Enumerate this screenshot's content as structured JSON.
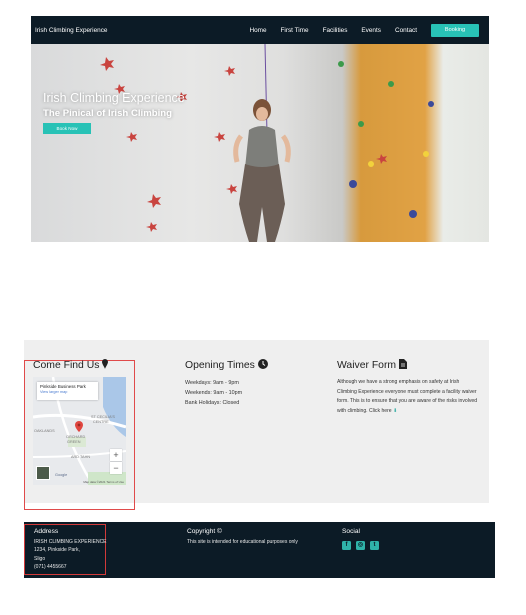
{
  "nav": {
    "brand": "Irish Climbing Experience",
    "links": [
      "Home",
      "First Time",
      "Facilities",
      "Events",
      "Contact"
    ],
    "cta": "Booking"
  },
  "hero": {
    "title": "Irish Climbing Experience",
    "subtitle": "The Pinical of Irish Climbing",
    "button": "Book Now"
  },
  "find_us": {
    "title": "Come Find Us",
    "icon": "map-marker-icon",
    "map": {
      "place": "Pinkside Business Park",
      "link": "View larger map",
      "labels": [
        "ST CECILIA'S",
        "CENTRE",
        "OAKLANDS",
        "ORCHARD",
        "GREEN",
        "ARD TAHN"
      ],
      "google": "Google",
      "footer": "Map data ©2021  Terms of Use"
    }
  },
  "opening": {
    "title": "Opening Times",
    "icon": "clock-icon",
    "lines": [
      "Weekdays: 9am - 9pm",
      "Weekends: 9am - 10pm",
      "Bank Holidays: Closed"
    ]
  },
  "waiver": {
    "title": "Waiver Form",
    "icon": "document-icon",
    "text": "Although we have a strong emphasis on safety at Irish Climbing Experience everyone must complete a facility waiver form. This is to ensure that you are aware of the risks involved with climbing. Click here",
    "link_icon": "download-icon"
  },
  "footer": {
    "address_title": "Address",
    "address_lines": [
      "IRISH CLIMBING EXPERIENCE",
      "1234, Pinkside Park,",
      "Sligo",
      "(071) 4455667"
    ],
    "copyright_title": "Copyright ©",
    "copyright_text": "This site is intended for educational purposes only",
    "social_title": "Social",
    "social_icons": [
      "facebook-icon",
      "instagram-icon",
      "twitter-icon"
    ]
  },
  "colors": {
    "nav": "#0c1b26",
    "accent": "#28c2b6",
    "panel": "#efefef"
  }
}
